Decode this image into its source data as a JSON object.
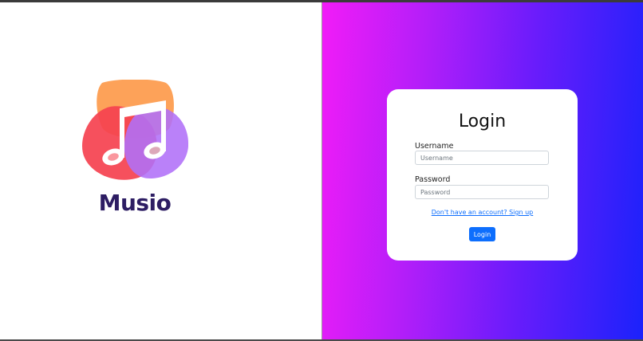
{
  "brand": {
    "name": "Musio",
    "logo_icon": "music-note-icon",
    "colors": {
      "text": "#2d1d63",
      "blob_orange": "#fd9a4b",
      "blob_red": "#f5414f",
      "blob_purple": "#b06ff8"
    }
  },
  "login": {
    "title": "Login",
    "username_label": "Username",
    "username_placeholder": "Username",
    "password_label": "Password",
    "password_placeholder": "Password",
    "signup_link": "Don't have an account? Sign up",
    "submit_label": "Login"
  },
  "colors": {
    "gradient_start": "#f21cf8",
    "gradient_end": "#1b22fb",
    "primary_button": "#0d6efd"
  }
}
